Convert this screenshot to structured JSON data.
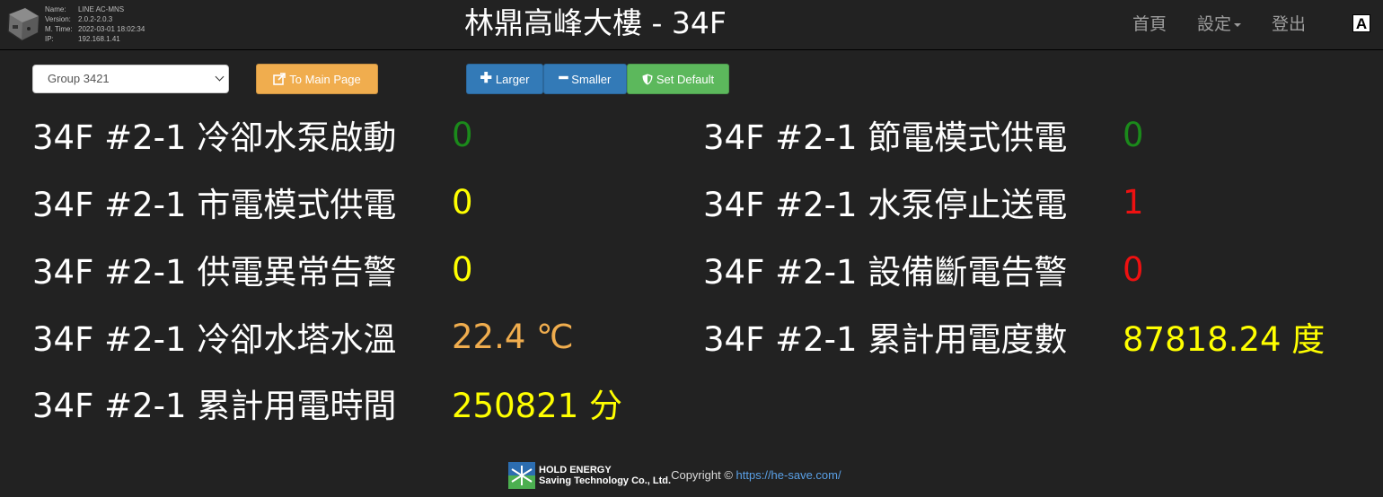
{
  "header": {
    "device": {
      "name_key": "Name:",
      "name_val": "LINE AC-MNS",
      "version_key": "Version:",
      "version_val": "2.0.2-2.0.3",
      "mtime_key": "M. Time:",
      "mtime_val": "2022-03-01 18:02:34",
      "ip_key": "IP:",
      "ip_val": "192.168.1.41"
    },
    "title": "林鼎高峰大樓 - 34F",
    "nav": {
      "home": "首頁",
      "settings": "設定",
      "logout": "登出",
      "font_toggle": "A"
    }
  },
  "toolbar": {
    "group_select": "Group 3421",
    "main_page": "To Main Page",
    "larger": "Larger",
    "smaller": "Smaller",
    "set_default": "Set Default",
    "colors": {
      "orange": "#f0ad4e",
      "blue": "#337ab7",
      "green": "#5cb85c"
    }
  },
  "readings": {
    "left": [
      {
        "label": "34F #2-1 冷卻水泵啟動",
        "value": "0",
        "color": "green"
      },
      {
        "label": "34F #2-1 市電模式供電",
        "value": "0",
        "color": "yellow"
      },
      {
        "label": "34F #2-1 供電異常告警",
        "value": "0",
        "color": "yellow"
      },
      {
        "label": "34F #2-1 冷卻水塔水溫",
        "value": "22.4 ℃",
        "color": "orange"
      },
      {
        "label": "34F #2-1 累計用電時間",
        "value": "250821 分",
        "color": "yellow"
      }
    ],
    "right": [
      {
        "label": "34F #2-1 節電模式供電",
        "value": "0",
        "color": "green"
      },
      {
        "label": "34F #2-1 水泵停止送電",
        "value": "1",
        "color": "red"
      },
      {
        "label": "34F #2-1 設備斷電告警",
        "value": "0",
        "color": "red"
      },
      {
        "label": "34F #2-1 累計用電度數",
        "value": "87818.24 度",
        "color": "yellow"
      }
    ]
  },
  "footer": {
    "company_line1": "HOLD ENERGY",
    "company_line2": "Saving Technology Co., Ltd.",
    "copyright": "Copyright ©",
    "url": "https://he-save.com/"
  }
}
